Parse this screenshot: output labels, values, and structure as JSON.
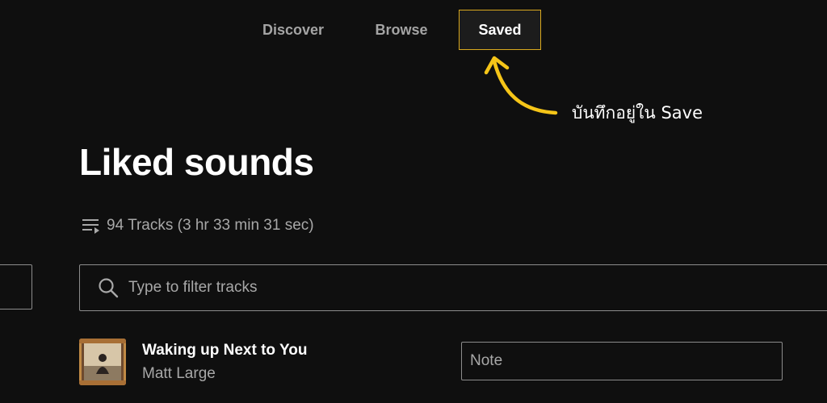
{
  "nav": {
    "tabs": [
      {
        "label": "Discover",
        "active": false
      },
      {
        "label": "Browse",
        "active": false
      },
      {
        "label": "Saved",
        "active": true
      }
    ]
  },
  "annotation": {
    "text": "บันทึกอยู่ใน Save",
    "color": "#f5c518"
  },
  "page": {
    "title": "Liked sounds",
    "track_count": "94 Tracks (3 hr 33 min 31 sec)"
  },
  "search": {
    "placeholder": "Type to filter tracks",
    "value": ""
  },
  "tracks": [
    {
      "title": "Waking up Next to You",
      "artist": "Matt Large",
      "note_placeholder": "Note",
      "note_value": ""
    }
  ],
  "icons": {
    "list": "playlist-icon",
    "search": "search-icon"
  },
  "colors": {
    "background": "#0f0f0f",
    "active_tab_border": "#d9a91f",
    "muted_text": "#a8a8a8",
    "border": "#8c8c8c"
  }
}
